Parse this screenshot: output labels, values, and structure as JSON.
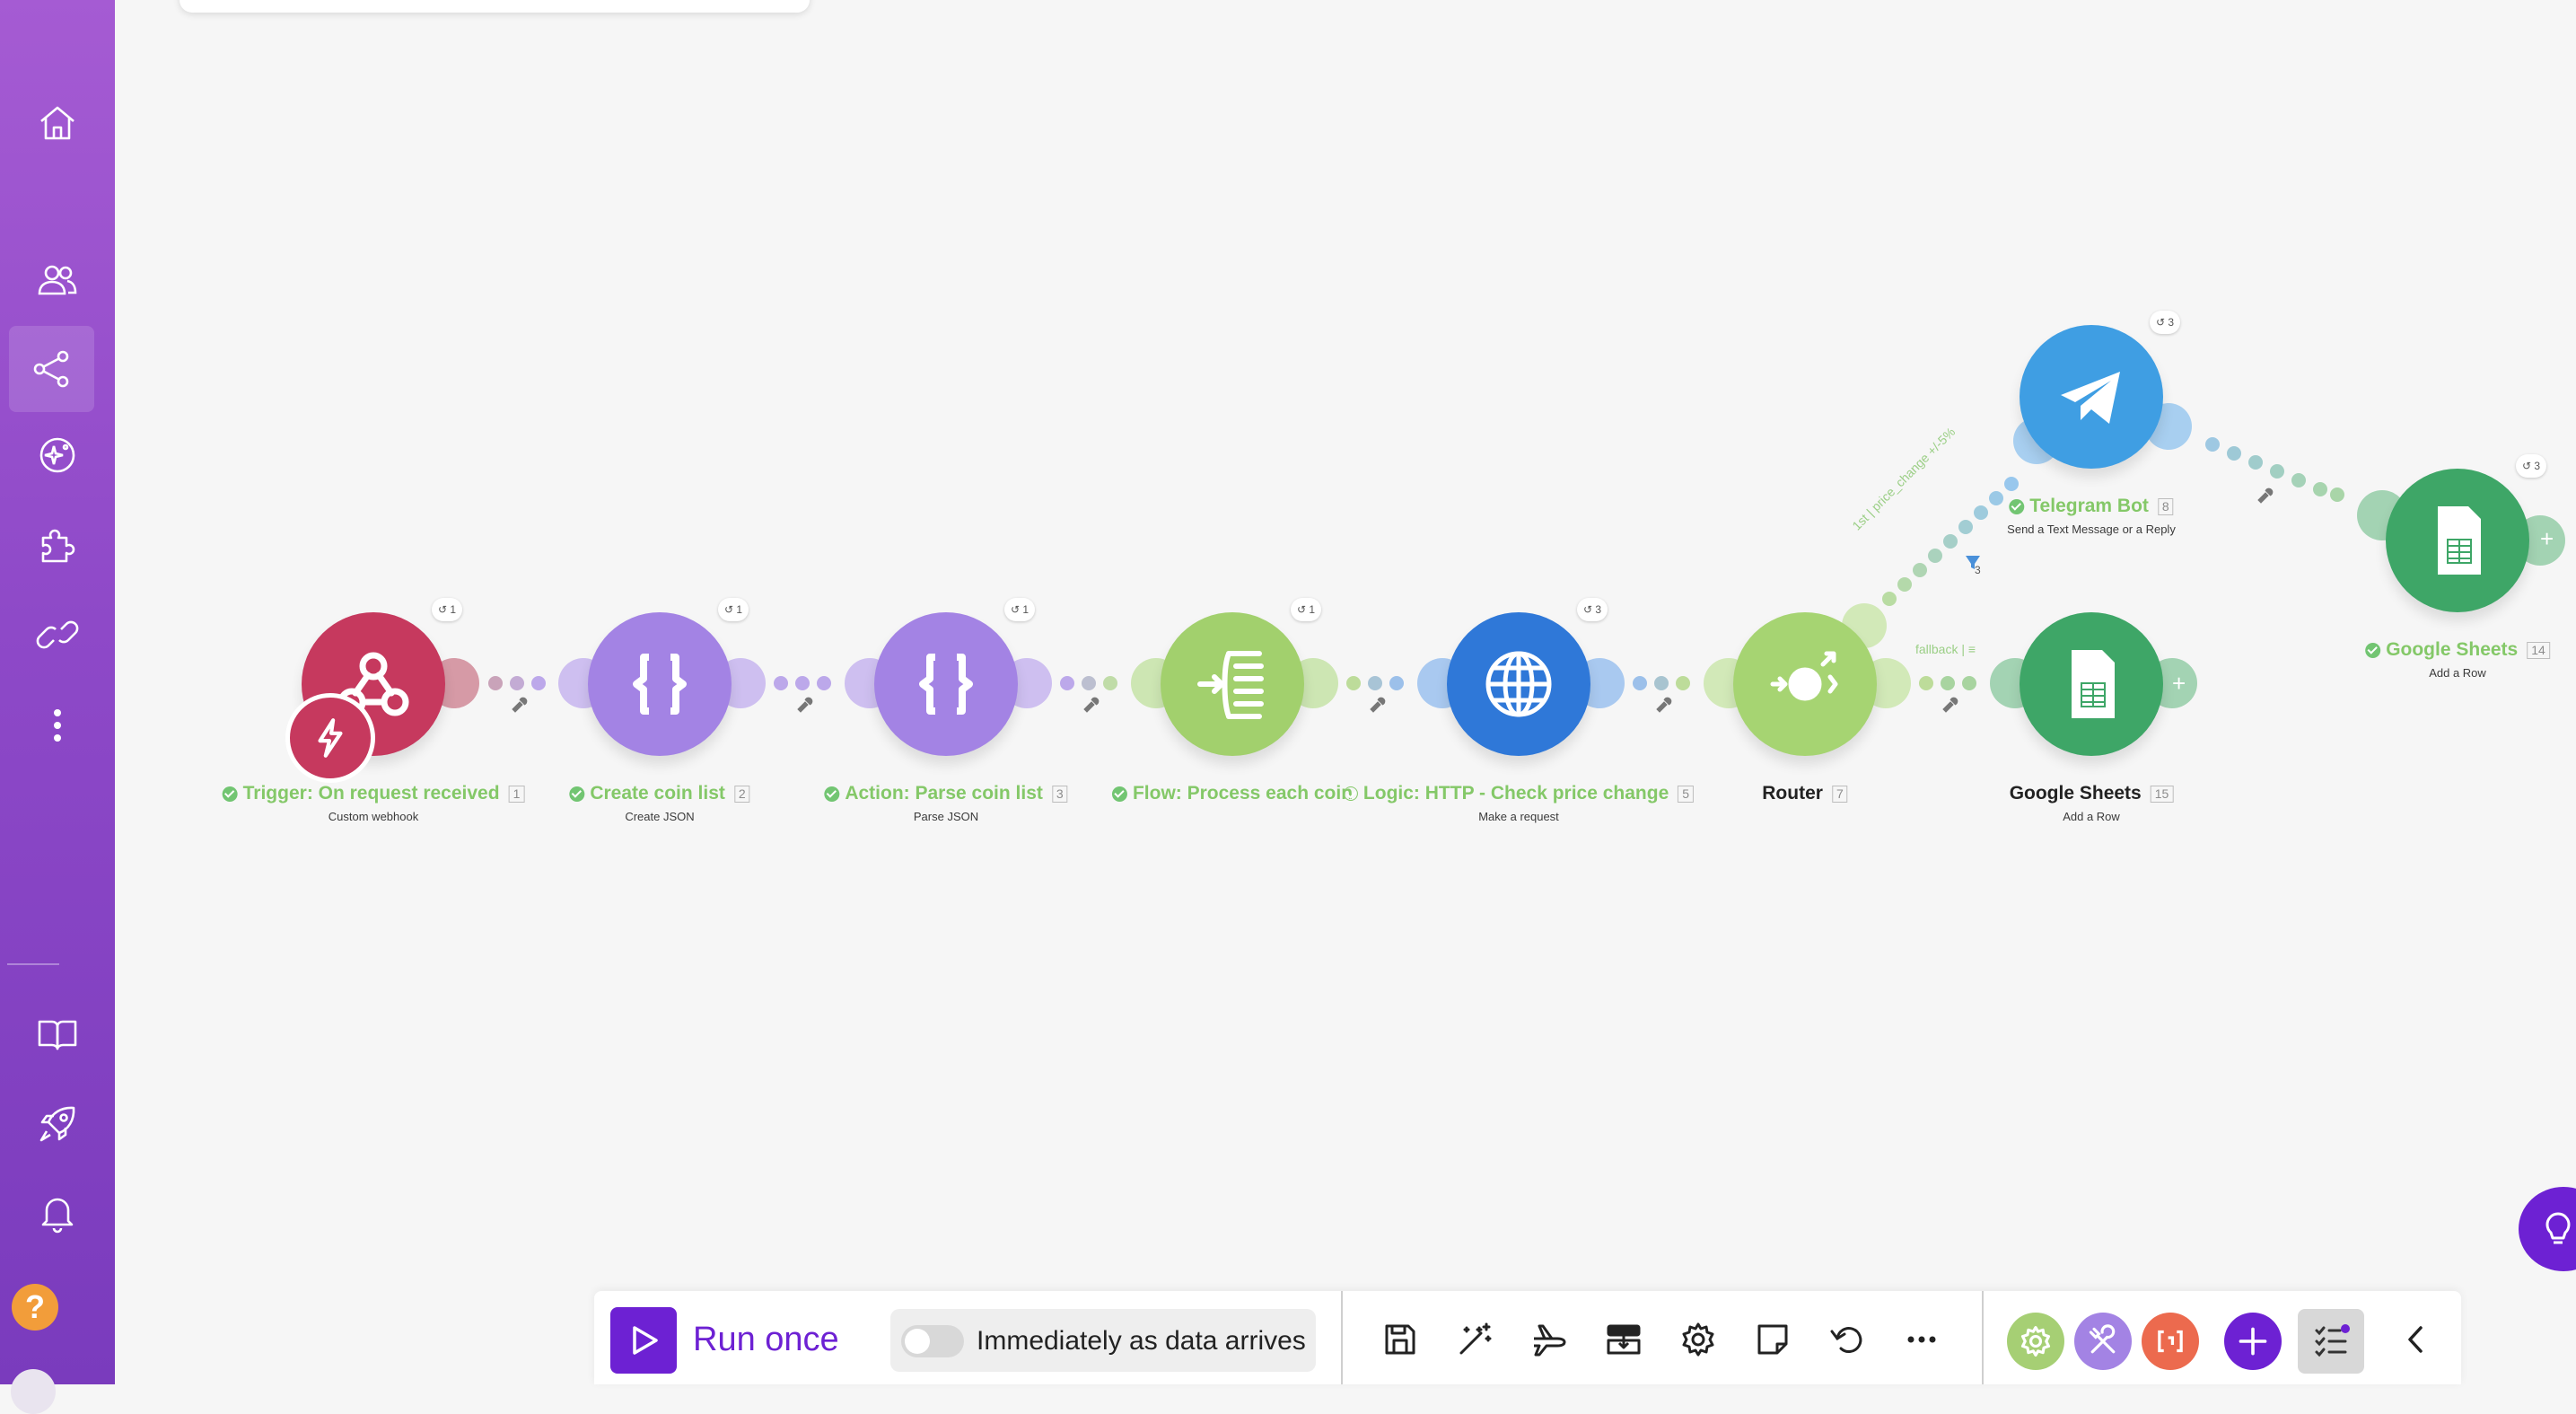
{
  "sidebar": {
    "items": [
      {
        "name": "home-icon",
        "active": false
      },
      {
        "name": "team-icon",
        "active": false
      },
      {
        "name": "scenarios-icon",
        "active": true
      },
      {
        "name": "ai-agents-icon",
        "active": false
      },
      {
        "name": "apps-icon",
        "active": false
      },
      {
        "name": "connections-icon",
        "active": false
      },
      {
        "name": "more-icon",
        "active": false
      }
    ],
    "bottom_items": [
      {
        "name": "docs-icon"
      },
      {
        "name": "whats-new-icon"
      },
      {
        "name": "notifications-icon"
      }
    ],
    "help_label": "?"
  },
  "modules": [
    {
      "id": "webhook",
      "label": "Trigger: On request received",
      "index": "1",
      "subtitle": "Custom webhook",
      "badge": "1",
      "color": "#c6395e",
      "check": true
    },
    {
      "id": "json-create",
      "label": "Create coin list",
      "index": "2",
      "subtitle": "Create JSON",
      "badge": "1",
      "color": "#a383e4",
      "check": true
    },
    {
      "id": "json-parse",
      "label": "Action: Parse coin list",
      "index": "3",
      "subtitle": "Parse JSON",
      "badge": "1",
      "color": "#a383e4",
      "check": true
    },
    {
      "id": "iterator",
      "label": "Flow: Process each coin",
      "index": "",
      "subtitle": "",
      "badge": "1",
      "color": "#a2d06d",
      "check": true
    },
    {
      "id": "http",
      "label": "Logic: HTTP - Check price change",
      "index": "5",
      "subtitle": "Make a request",
      "badge": "3",
      "color": "#2f78d8",
      "check": false
    },
    {
      "id": "router",
      "label": "Router",
      "index": "7",
      "subtitle": "",
      "badge": "",
      "color": "#a6d472",
      "check": false
    },
    {
      "id": "sheets-fallback",
      "label": "Google Sheets",
      "index": "15",
      "subtitle": "Add a Row",
      "badge": "",
      "color": "#3ea667",
      "check": false
    },
    {
      "id": "telegram",
      "label": "Telegram Bot",
      "index": "8",
      "subtitle": "Send a Text Message or a Reply",
      "badge": "3",
      "color": "#3f9ee3",
      "check": true
    },
    {
      "id": "sheets-main",
      "label": "Google Sheets",
      "index": "14",
      "subtitle": "Add a Row",
      "badge": "3",
      "color": "#3ea667",
      "check": true
    }
  ],
  "routes": {
    "first": "1st | price_change +/-5%",
    "fallback": "fallback | ≡",
    "filter_count": "3"
  },
  "toolbar": {
    "run_label": "Run once",
    "schedule_label": "Immediately as data arrives",
    "schedule_on": false,
    "icons": [
      "save-icon",
      "auto-align-icon",
      "explain-flow-icon",
      "scenario-io-icon",
      "settings-icon",
      "notes-icon",
      "undo-icon",
      "more-icon"
    ],
    "quick": [
      {
        "name": "tools-gear-icon",
        "color": "#a6cf74"
      },
      {
        "name": "tools-wrench-icon",
        "color": "#a383e4"
      },
      {
        "name": "text-parser-icon",
        "color": "#ec6a4e"
      }
    ]
  }
}
